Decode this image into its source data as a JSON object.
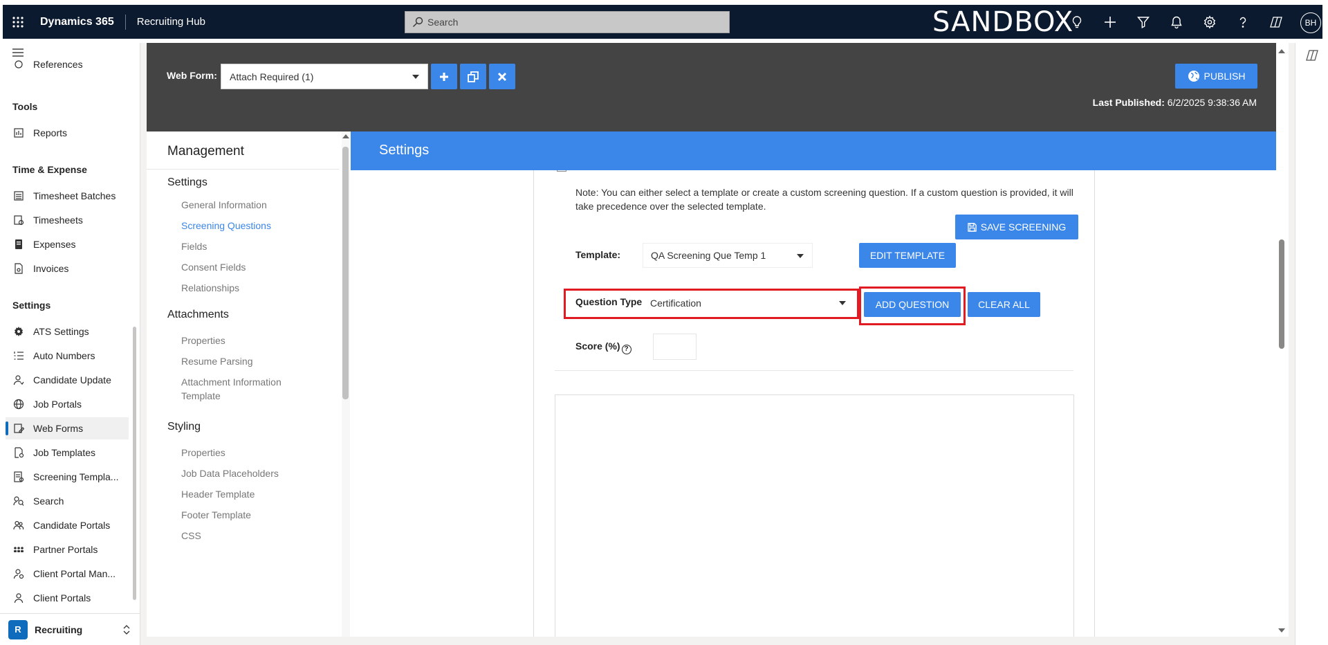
{
  "topbar": {
    "brand": "Dynamics 365",
    "app_name": "Recruiting Hub",
    "search_placeholder": "Search",
    "environment": "SANDBOX",
    "avatar_initials": "BH",
    "icons": [
      "lightbulb-icon",
      "plus-icon",
      "filter-icon",
      "bell-icon",
      "gear-icon",
      "help-icon",
      "copilot-icon"
    ]
  },
  "leftnav": {
    "partial_top_item": "References",
    "sections": [
      {
        "title": "Tools",
        "items": [
          {
            "label": "Reports",
            "icon": "reports-icon"
          }
        ]
      },
      {
        "title": "Time & Expense",
        "items": [
          {
            "label": "Timesheet Batches",
            "icon": "batches-icon"
          },
          {
            "label": "Timesheets",
            "icon": "timesheets-icon"
          },
          {
            "label": "Expenses",
            "icon": "expenses-icon"
          },
          {
            "label": "Invoices",
            "icon": "invoices-icon"
          }
        ]
      },
      {
        "title": "Settings",
        "items": [
          {
            "label": "ATS Settings",
            "icon": "gear-icon"
          },
          {
            "label": "Auto Numbers",
            "icon": "numbered-list-icon"
          },
          {
            "label": "Candidate Update",
            "icon": "person-sync-icon"
          },
          {
            "label": "Job Portals",
            "icon": "globe-icon"
          },
          {
            "label": "Web Forms",
            "icon": "form-edit-icon",
            "active": true
          },
          {
            "label": "Job Templates",
            "icon": "template-icon"
          },
          {
            "label": "Screening Templa...",
            "icon": "screening-icon"
          },
          {
            "label": "Search",
            "icon": "search-people-icon"
          },
          {
            "label": "Candidate Portals",
            "icon": "people-icon"
          },
          {
            "label": "Partner Portals",
            "icon": "partners-icon"
          },
          {
            "label": "Client Portal Man...",
            "icon": "client-manage-icon"
          },
          {
            "label": "Client Portals",
            "icon": "person-icon"
          }
        ]
      }
    ],
    "area": {
      "badge": "R",
      "name": "Recruiting"
    }
  },
  "header": {
    "web_form_label": "Web Form:",
    "web_form_value": "Attach Required (1)",
    "publish_label": "PUBLISH",
    "last_published_label": "Last Published:",
    "last_published_value": "6/2/2025 9:38:36 AM"
  },
  "management": {
    "title": "Management",
    "groups": [
      {
        "title": "Settings",
        "links": [
          "General Information",
          "Screening Questions",
          "Fields",
          "Consent Fields",
          "Relationships"
        ],
        "selected": "Screening Questions"
      },
      {
        "title": "Attachments",
        "links": [
          "Properties",
          "Resume Parsing",
          "Attachment Information Template"
        ]
      },
      {
        "title": "Styling",
        "links": [
          "Properties",
          "Job Data Placeholders",
          "Header Template",
          "Footer Template",
          "CSS"
        ]
      }
    ]
  },
  "settings": {
    "title": "Settings",
    "note": "Note: You can either select a template or create a custom screening question. If a custom question is provided, it will take precedence over the selected template.",
    "save_label": "SAVE SCREENING",
    "template_label": "Template:",
    "template_value": "QA Screening Que Temp 1",
    "edit_template_label": "EDIT TEMPLATE",
    "question_type_label": "Question Type:",
    "question_type_value": "Certification",
    "add_question_label": "ADD QUESTION",
    "clear_all_label": "CLEAR ALL",
    "score_label": "Score (%)",
    "score_help": "?",
    "score_value": ""
  },
  "colors": {
    "accent": "#3b86e9",
    "topbar": "#0c1a2f",
    "header_band": "#444444",
    "highlight": "#e21a22"
  }
}
